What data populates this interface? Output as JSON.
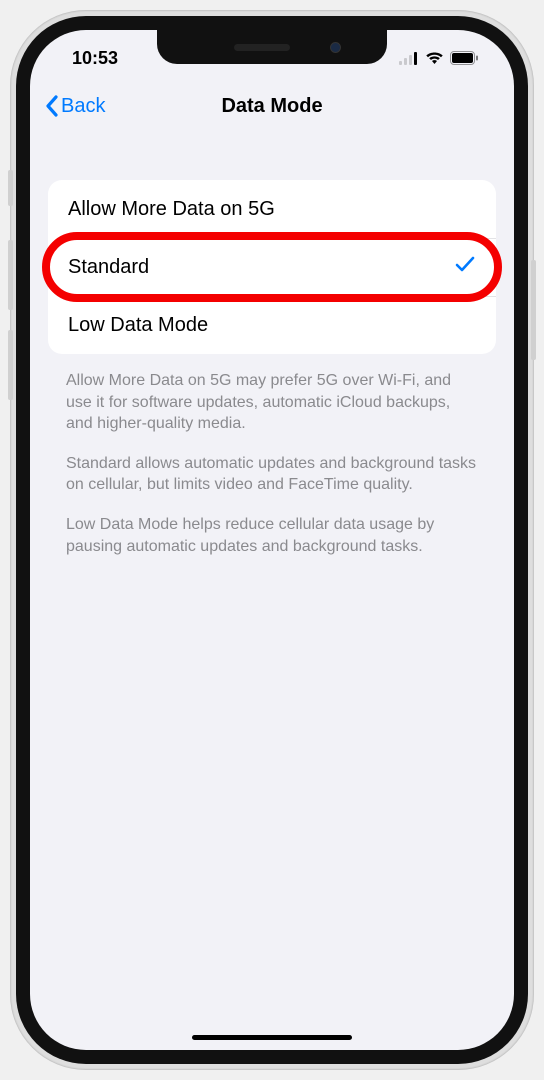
{
  "statusBar": {
    "time": "10:53"
  },
  "nav": {
    "backLabel": "Back",
    "title": "Data Mode"
  },
  "options": {
    "item0": {
      "label": "Allow More Data on 5G",
      "selected": false
    },
    "item1": {
      "label": "Standard",
      "selected": true,
      "highlighted": true
    },
    "item2": {
      "label": "Low Data Mode",
      "selected": false
    }
  },
  "footer": {
    "p1": "Allow More Data on 5G may prefer 5G over Wi-Fi, and use it for software updates, automatic iCloud backups, and higher-quality media.",
    "p2": "Standard allows automatic updates and background tasks on cellular, but limits video and FaceTime quality.",
    "p3": "Low Data Mode helps reduce cellular data usage by pausing automatic updates and background tasks."
  }
}
